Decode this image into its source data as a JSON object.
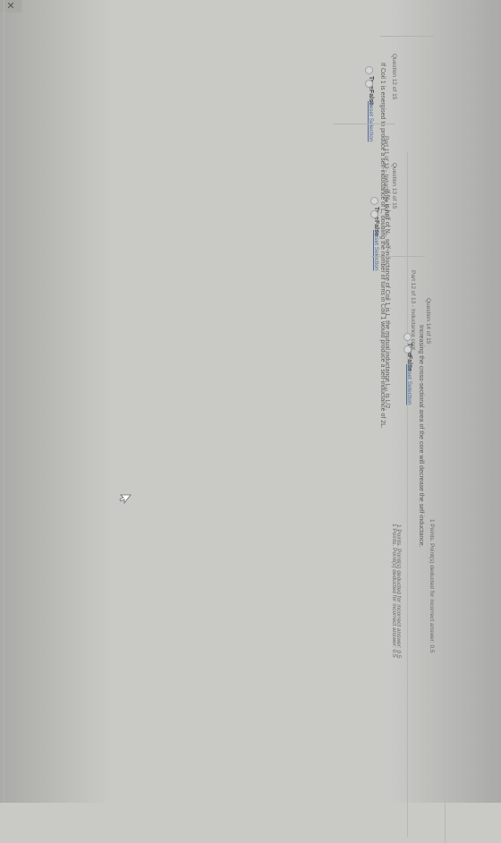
{
  "window": {
    "close_glyph": "✕"
  },
  "q12": {
    "question_label": "Question 12 of 15",
    "points_text": "1 Points. Point(s) deducted for incorrect answer: 0.5",
    "prompt": "If Coil 1 is energised to produce a self-inductance of L, doubling the number of turns in Coil 1 would produce a self-inductance of 2L.",
    "options": [
      "True",
      "False"
    ],
    "reset_label": "Reset Selection"
  },
  "part11": {
    "title": "Part 11 of 13 - Inductance cont."
  },
  "q13": {
    "question_label": "Question 13 of 15",
    "points_text": "1 Points. Point(s) deducted for incorrect answer: 0.5",
    "prompt": "If N₂ is half of N₁, self-inductance of Coil 1 is L, the mutual inductance L₂₁ is L/2.",
    "options": [
      "True",
      "False"
    ],
    "reset_label": "Reset Selection"
  },
  "part12": {
    "title": "Part 12 of 13 - Inductance cont."
  },
  "q14": {
    "question_label": "Question 14 of 15",
    "points_text": "1 Points. Point(s) deducted for incorrect answer: 0.5",
    "prompt": "Increasing the cross-sectional area of the core will decrease the self-inductance.",
    "options": [
      "True",
      "False"
    ],
    "reset_label": "Reset Selection"
  },
  "icons": {
    "close": "close-icon",
    "cursor": "mouse-cursor-icon",
    "radio": "radio-button-icon"
  }
}
